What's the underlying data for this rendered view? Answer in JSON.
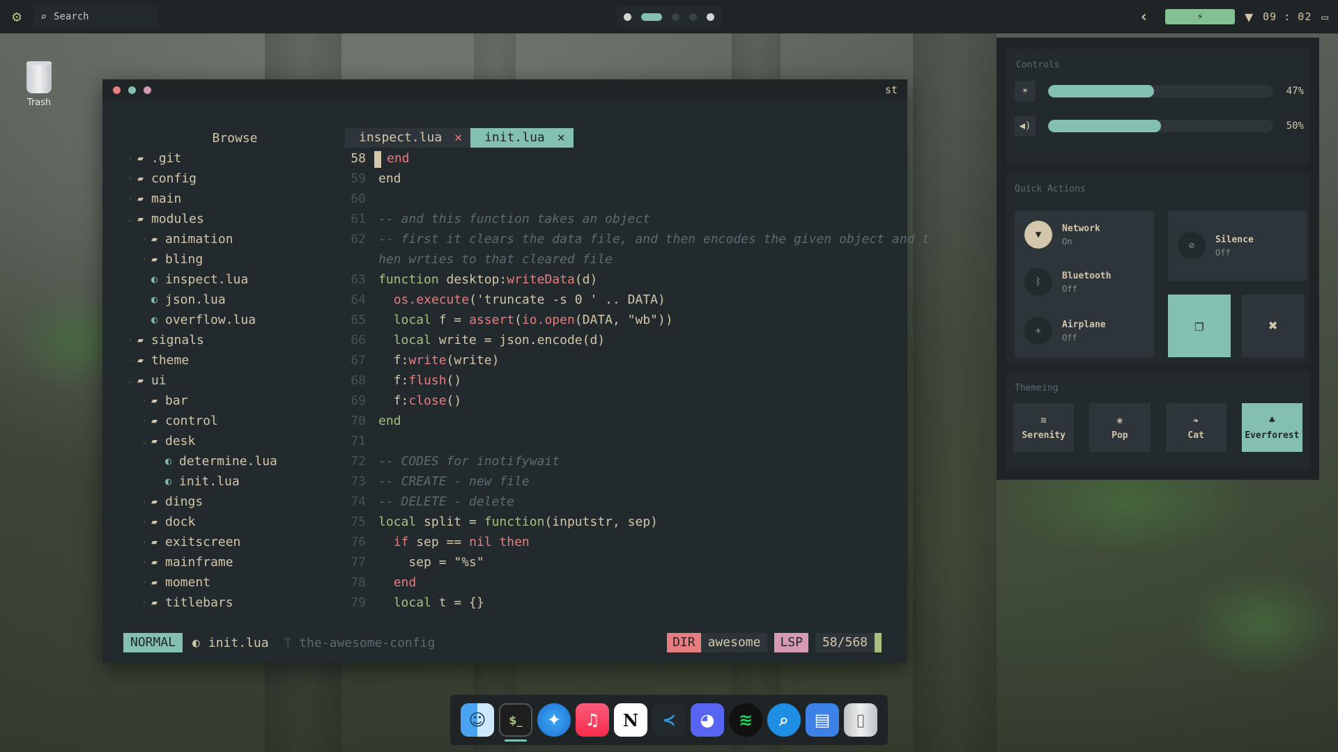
{
  "topbar": {
    "search_label": "Search",
    "clock": "09 : 02"
  },
  "desktop": {
    "trash_label": "Trash"
  },
  "terminal": {
    "title": "st",
    "tree": {
      "header": "Browse",
      "rows": [
        {
          "name": ".git",
          "type": "dir",
          "depth": 0
        },
        {
          "name": "config",
          "type": "dir",
          "depth": 0
        },
        {
          "name": "main",
          "type": "dir",
          "depth": 0
        },
        {
          "name": "modules",
          "type": "open",
          "depth": 0
        },
        {
          "name": "animation",
          "type": "dir",
          "depth": 1
        },
        {
          "name": "bling",
          "type": "dir",
          "depth": 1
        },
        {
          "name": "inspect.lua",
          "type": "lua",
          "depth": 1
        },
        {
          "name": "json.lua",
          "type": "lua",
          "depth": 1
        },
        {
          "name": "overflow.lua",
          "type": "lua",
          "depth": 1
        },
        {
          "name": "signals",
          "type": "dir",
          "depth": 0
        },
        {
          "name": "theme",
          "type": "dir",
          "depth": 0
        },
        {
          "name": "ui",
          "type": "open",
          "depth": 0
        },
        {
          "name": "bar",
          "type": "dir",
          "depth": 1
        },
        {
          "name": "control",
          "type": "dir",
          "depth": 1
        },
        {
          "name": "desk",
          "type": "open",
          "depth": 1
        },
        {
          "name": "determine.lua",
          "type": "lua",
          "depth": 2
        },
        {
          "name": "init.lua",
          "type": "lua",
          "depth": 2
        },
        {
          "name": "dings",
          "type": "dir",
          "depth": 1
        },
        {
          "name": "dock",
          "type": "dir",
          "depth": 1
        },
        {
          "name": "exitscreen",
          "type": "dir",
          "depth": 1
        },
        {
          "name": "mainframe",
          "type": "dir",
          "depth": 1
        },
        {
          "name": "moment",
          "type": "dir",
          "depth": 1
        },
        {
          "name": "titlebars",
          "type": "dir",
          "depth": 1
        }
      ]
    },
    "tabs": [
      {
        "label": "inspect.lua",
        "close": "✕",
        "active": false
      },
      {
        "label": "init.lua",
        "close": "✕",
        "active": true
      }
    ],
    "code_lines": [
      {
        "n": "58",
        "cur": true,
        "parts": [
          [
            "kw",
            "end"
          ]
        ]
      },
      {
        "n": "59",
        "parts": [
          [
            "tx",
            "end"
          ]
        ]
      },
      {
        "n": "60",
        "parts": []
      },
      {
        "n": "61",
        "parts": [
          [
            "cm",
            "-- and this function takes an object"
          ]
        ]
      },
      {
        "n": "62",
        "parts": [
          [
            "cm",
            "-- first it clears the data file, and then encodes the given object and t"
          ]
        ]
      },
      {
        "n": "",
        "parts": [
          [
            "cm",
            "hen wrties to that cleared file"
          ]
        ]
      },
      {
        "n": "63",
        "parts": [
          [
            "fn",
            "function "
          ],
          [
            "tx",
            "desktop:"
          ],
          [
            "bi",
            "writeData"
          ],
          [
            "tx",
            "(d)"
          ]
        ]
      },
      {
        "n": "64",
        "parts": [
          [
            "tx",
            "  "
          ],
          [
            "bi",
            "os.execute"
          ],
          [
            "tx",
            "('truncate -s 0 ' .. DATA)"
          ]
        ]
      },
      {
        "n": "65",
        "parts": [
          [
            "tx",
            "  "
          ],
          [
            "fn",
            "local"
          ],
          [
            "tx",
            " f = "
          ],
          [
            "bi",
            "assert"
          ],
          [
            "tx",
            "("
          ],
          [
            "bi",
            "io.open"
          ],
          [
            "tx",
            "(DATA, \"wb\"))"
          ]
        ]
      },
      {
        "n": "66",
        "parts": [
          [
            "tx",
            "  "
          ],
          [
            "fn",
            "local"
          ],
          [
            "tx",
            " write = json.encode(d)"
          ]
        ]
      },
      {
        "n": "67",
        "parts": [
          [
            "tx",
            "  f:"
          ],
          [
            "bi",
            "write"
          ],
          [
            "tx",
            "(write)"
          ]
        ]
      },
      {
        "n": "68",
        "parts": [
          [
            "tx",
            "  f:"
          ],
          [
            "bi",
            "flush"
          ],
          [
            "tx",
            "()"
          ]
        ]
      },
      {
        "n": "69",
        "parts": [
          [
            "tx",
            "  f:"
          ],
          [
            "bi",
            "close"
          ],
          [
            "tx",
            "()"
          ]
        ]
      },
      {
        "n": "70",
        "parts": [
          [
            "fn",
            "end"
          ]
        ]
      },
      {
        "n": "71",
        "parts": []
      },
      {
        "n": "72",
        "parts": [
          [
            "cm",
            "-- CODES for inotifywait"
          ]
        ]
      },
      {
        "n": "73",
        "parts": [
          [
            "cm",
            "-- CREATE - new file"
          ]
        ]
      },
      {
        "n": "74",
        "parts": [
          [
            "cm",
            "-- DELETE - delete"
          ]
        ]
      },
      {
        "n": "75",
        "parts": [
          [
            "fn",
            "local"
          ],
          [
            "tx",
            " split = "
          ],
          [
            "fn",
            "function"
          ],
          [
            "tx",
            "(inputstr, sep)"
          ]
        ]
      },
      {
        "n": "76",
        "parts": [
          [
            "tx",
            "  "
          ],
          [
            "kw",
            "if"
          ],
          [
            "tx",
            " sep == "
          ],
          [
            "kw",
            "nil then"
          ]
        ]
      },
      {
        "n": "77",
        "parts": [
          [
            "tx",
            "    sep = \"%s\""
          ]
        ]
      },
      {
        "n": "78",
        "parts": [
          [
            "tx",
            "  "
          ],
          [
            "kw",
            "end"
          ]
        ]
      },
      {
        "n": "79",
        "parts": [
          [
            "tx",
            "  "
          ],
          [
            "fn",
            "local"
          ],
          [
            "tx",
            " t = {}"
          ]
        ]
      }
    ],
    "status": {
      "mode": "NORMAL",
      "file": "init.lua",
      "git": "the-awesome-config",
      "dir_label": "DIR",
      "dir_value": "awesome",
      "lsp": "LSP",
      "position": "58/568"
    }
  },
  "control_center": {
    "controls_title": "Controls",
    "brightness": {
      "icon": "brightness-icon",
      "percent": 47,
      "label": "47%"
    },
    "volume": {
      "icon": "volume-icon",
      "percent": 50,
      "label": "50%"
    },
    "quick_title": "Quick Actions",
    "network": {
      "title": "Network",
      "state": "On"
    },
    "bluetooth": {
      "title": "Bluetooth",
      "state": "Off"
    },
    "airplane": {
      "title": "Airplane",
      "state": "Off"
    },
    "silence": {
      "title": "Silence",
      "state": "Off"
    },
    "theme_title": "Themeing",
    "themes": [
      {
        "label": "Serenity",
        "icon": "≋",
        "active": false
      },
      {
        "label": "Pop",
        "icon": "❀",
        "active": false
      },
      {
        "label": "Cat",
        "icon": "❧",
        "active": false
      },
      {
        "label": "Everforest",
        "icon": "♣",
        "active": true
      }
    ]
  },
  "colors": {
    "bg": "#232a2d",
    "accent": "#83c0b0",
    "red": "#e67e80",
    "green": "#a7c080",
    "pink": "#d699b6"
  },
  "dock": {
    "apps": [
      "finder-icon",
      "terminal-icon",
      "safari-icon",
      "music-icon",
      "notion-icon",
      "vscode-icon",
      "discord-icon",
      "spotify-icon",
      "search-icon",
      "files-icon",
      "trash-icon"
    ]
  }
}
